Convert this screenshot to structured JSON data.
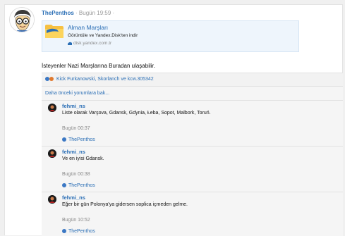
{
  "post": {
    "author": "ThePenthos",
    "separator": "·",
    "time": "Bugün 19:59",
    "trailing_separator": "·",
    "text": "İsteyenler Nazi Marşlarına Buradan ulaşabilir."
  },
  "link_card": {
    "title": "Alman Marşları",
    "description": "Görüntüle ve Yandex.Disk'ten indir",
    "domain": "disk.yandex.com.tr",
    "icon": "folder-icon"
  },
  "likes": {
    "text": "Kick Furkanowski, Skorlanch ve kcw.305342"
  },
  "comments_section": {
    "earlier_link": "Daha önceki yorumlara bak...",
    "comments": [
      {
        "author": "fehmi_ns",
        "text": "Liste olarak Varşova, Gdansk, Gdynia, Łeba, Sopot, Malbork, Toruń.",
        "time": "Bugün 00:37",
        "reply_to": "ThePenthos"
      },
      {
        "author": "fehmi_ns",
        "text": "Ve en iyisi Gdansk.",
        "time": "Bugün 00:38",
        "reply_to": "ThePenthos"
      },
      {
        "author": "fehmi_ns",
        "text": "Eğer bir gün Polonya'ya gidersen soplica içmeden gelme.",
        "time": "Bugün 10:52",
        "reply_to": "ThePenthos"
      }
    ]
  },
  "colors": {
    "link": "#2a6eb5",
    "card_bg": "#eef5fc",
    "muted": "#888888"
  }
}
